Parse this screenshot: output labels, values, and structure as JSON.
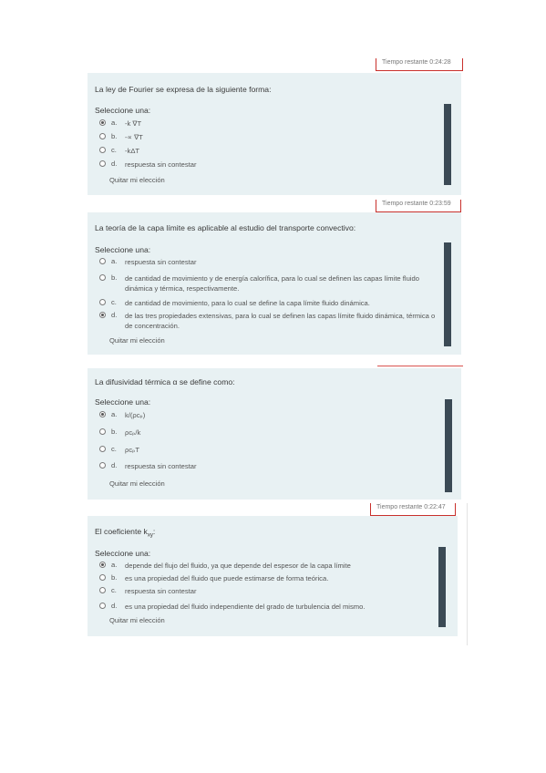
{
  "timer1": "Tiempo restante 0:24:28",
  "timer2": "Tiempo restante 0:23:59",
  "timer4": "Tiempo restante 0:22:47",
  "select_one": "Seleccione una:",
  "clear_choice": "Quitar mi elección",
  "q1": {
    "text": "La ley de Fourier se expresa de la siguiente forma:",
    "options": [
      {
        "letter": "a.",
        "text": "-k ∇T",
        "selected": true
      },
      {
        "letter": "b.",
        "text": "-∝ ∇T",
        "selected": false
      },
      {
        "letter": "c.",
        "text": "-kΔT",
        "selected": false
      },
      {
        "letter": "d.",
        "text": "respuesta sin contestar",
        "selected": false
      }
    ]
  },
  "q2": {
    "text": "La teoría de la capa límite es aplicable al estudio del transporte convectivo:",
    "options": [
      {
        "letter": "a.",
        "text": "respuesta sin contestar",
        "selected": false
      },
      {
        "letter": "b.",
        "text": "de cantidad de movimiento y de energía calorífica, para lo cual se definen las capas límite fluido dinámica y térmica, respectivamente.",
        "selected": false
      },
      {
        "letter": "c.",
        "text": "de cantidad de movimiento, para lo cual se define la capa límite fluido dinámica.",
        "selected": false
      },
      {
        "letter": "d.",
        "text": "de las tres propiedades extensivas, para lo cual se definen las capas límite fluido dinámica, térmica o de concentración.",
        "selected": true
      }
    ]
  },
  "q3": {
    "text": "La difusividad térmica α se define como:",
    "options": [
      {
        "letter": "a.",
        "text": "k/(ρcₚ)",
        "selected": true
      },
      {
        "letter": "b.",
        "text": "ρcₚ/k",
        "selected": false
      },
      {
        "letter": "c.",
        "text": "ρcₚT",
        "selected": false
      },
      {
        "letter": "d.",
        "text": "respuesta sin contestar",
        "selected": false
      }
    ]
  },
  "q4": {
    "text_prefix": "El coeficiente k",
    "text_sub": "xy",
    "text_suffix": ":",
    "options": [
      {
        "letter": "a.",
        "text": "depende del flujo del fluido, ya que depende del espesor de la capa límite",
        "selected": true
      },
      {
        "letter": "b.",
        "text": "es una propiedad del fluido que puede estimarse de forma teórica.",
        "selected": false
      },
      {
        "letter": "c.",
        "text": "respuesta sin contestar",
        "selected": false
      },
      {
        "letter": "d.",
        "text": "es una propiedad del fluido independiente del grado de turbulencia del mismo.",
        "selected": false
      }
    ]
  },
  "colors": {
    "card_bg": "#e8f1f3",
    "scrollbar": "#3b4a55",
    "timer_border": "#c9302c"
  }
}
